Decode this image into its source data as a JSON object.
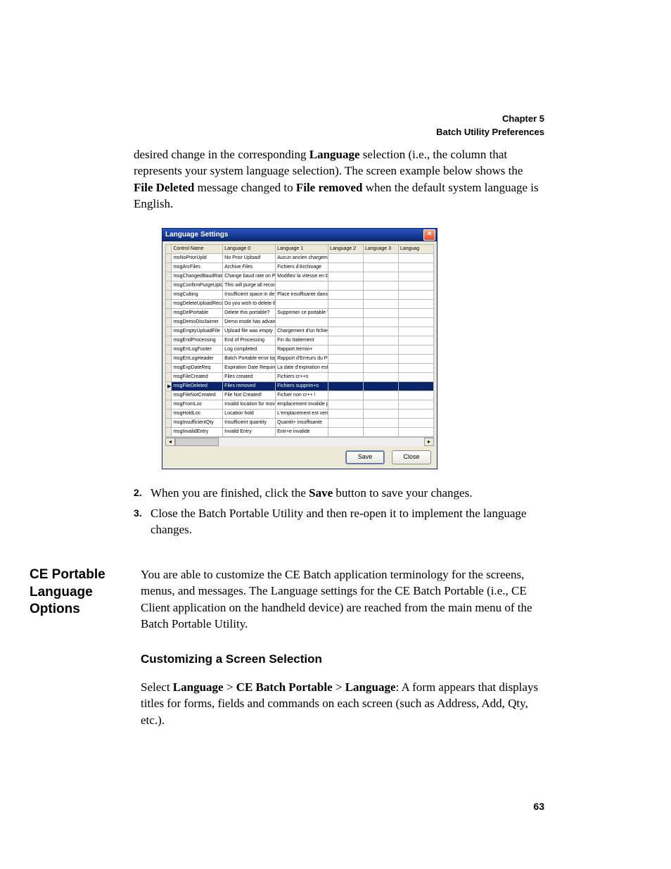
{
  "header": {
    "chapter": "Chapter 5",
    "title": "Batch Utility Preferences"
  },
  "intro": {
    "prefix": "desired change in the corresponding ",
    "b1": "Language",
    "mid1": " selection (i.e., the column that represents your system language selection). The screen example below shows the ",
    "b2": "File Deleted",
    "mid2": " message changed to ",
    "b3": "File removed",
    "suffix": " when the default system language is English."
  },
  "window": {
    "title": "Language Settings",
    "headers": [
      "Control Name",
      "Language 0",
      "Language 1",
      "Language 2",
      "Language 3",
      "Languag"
    ],
    "rows": [
      {
        "marker": "",
        "cells": [
          "msNoPriorUpld",
          "No Prior Upload!",
          "Aucun ancien chargem",
          "",
          "",
          ""
        ]
      },
      {
        "marker": "",
        "cells": [
          "msgArcFiles",
          "Archive Files",
          "Fichiers d'Archivage",
          "",
          "",
          ""
        ]
      },
      {
        "marker": "",
        "cells": [
          "msgChangedBaudRate",
          "Change baud rate on P",
          "Modifiez la vitesse en b",
          "",
          "",
          ""
        ]
      },
      {
        "marker": "",
        "cells": [
          "msgConfirmPurgeUploa",
          "This will purge all record",
          "",
          "",
          "",
          ""
        ]
      },
      {
        "marker": "",
        "cells": [
          "msgCubing",
          "Insufficient space in de",
          "Place insuffisante dans",
          "",
          "",
          ""
        ]
      },
      {
        "marker": "",
        "cells": [
          "msgDeleteUploadReco",
          "Do you wish to delete th",
          "",
          "",
          "",
          ""
        ]
      },
      {
        "marker": "",
        "cells": [
          "msgDelPortable",
          "Delete this portable?",
          "Supprimer ce portable ?",
          "",
          "",
          ""
        ]
      },
      {
        "marker": "",
        "cells": [
          "msgDemoDisclaimer",
          "Demo mode has advant",
          "",
          "",
          "",
          ""
        ]
      },
      {
        "marker": "",
        "cells": [
          "msgEmptyUploadFile",
          "Upload file was empty",
          "Chargement d'un fichier",
          "",
          "",
          ""
        ]
      },
      {
        "marker": "",
        "cells": [
          "msgEndProcessing",
          "End of Processing",
          "Fin du traitement",
          "",
          "",
          ""
        ]
      },
      {
        "marker": "",
        "cells": [
          "msgErrLogFooter",
          "Log completed",
          "Rapport termin+",
          "",
          "",
          ""
        ]
      },
      {
        "marker": "",
        "cells": [
          "msgErrLogHeader",
          "Batch Portable error log",
          "Rapport d'Erreurs du Po",
          "",
          "",
          ""
        ]
      },
      {
        "marker": "",
        "cells": [
          "msgExpDateReq",
          "Expiration Date Require",
          "La date d'expiration est",
          "",
          "",
          ""
        ]
      },
      {
        "marker": "",
        "cells": [
          "msgFileCreated",
          "Files created",
          "Fichiers cr++s",
          "",
          "",
          ""
        ]
      },
      {
        "marker": "▶",
        "selected": true,
        "cells": [
          "msgFileDeleted",
          "Files removed",
          "Fichiers supprim+s",
          "",
          "",
          ""
        ]
      },
      {
        "marker": "",
        "cells": [
          "msgFileNotCreated",
          "File Not Created!",
          "Fichier non cr++ !",
          "",
          "",
          ""
        ]
      },
      {
        "marker": "",
        "cells": [
          "msgFromLoc",
          "Invalid location for move",
          "emplacement invalide p",
          "",
          "",
          ""
        ]
      },
      {
        "marker": "",
        "cells": [
          "msgHoldLoc",
          "Location hold",
          "L'emplacement est verr",
          "",
          "",
          ""
        ]
      },
      {
        "marker": "",
        "cells": [
          "msgInsufficientQty",
          "Insufficient quantity",
          "Quantit+ insuffisante",
          "",
          "",
          ""
        ]
      },
      {
        "marker": "",
        "cells": [
          "msgInvalidEntry",
          "Invalid Entry",
          "Entr+e invalide",
          "",
          "",
          ""
        ]
      }
    ],
    "buttons": {
      "save": "Save",
      "close": "Close"
    }
  },
  "steps": [
    {
      "num": "2.",
      "pre": "When you are finished, click the ",
      "b": "Save",
      "post": " button to save your changes."
    },
    {
      "num": "3.",
      "pre": "Close the Batch Portable Utility and then re-open it to implement the language changes.",
      "b": "",
      "post": ""
    }
  ],
  "section": {
    "side_title": "CE Portable Language Options",
    "para": "You are able to customize the CE Batch application terminology for the screens, menus, and messages. The Language settings for the CE Batch Portable (i.e., CE Client application on the handheld device) are reached from the main menu of the Batch Portable Utility.",
    "subhead": "Customizing a Screen Selection",
    "p2_pre": "Select ",
    "p2_b1": "Language",
    "p2_sep1": " > ",
    "p2_b2": "CE Batch Portable",
    "p2_sep2": " > ",
    "p2_b3": "Language",
    "p2_post": ": A form appears that displays titles for forms, fields and commands on each screen (such as Address, Add, Qty, etc.)."
  },
  "page_number": "63"
}
